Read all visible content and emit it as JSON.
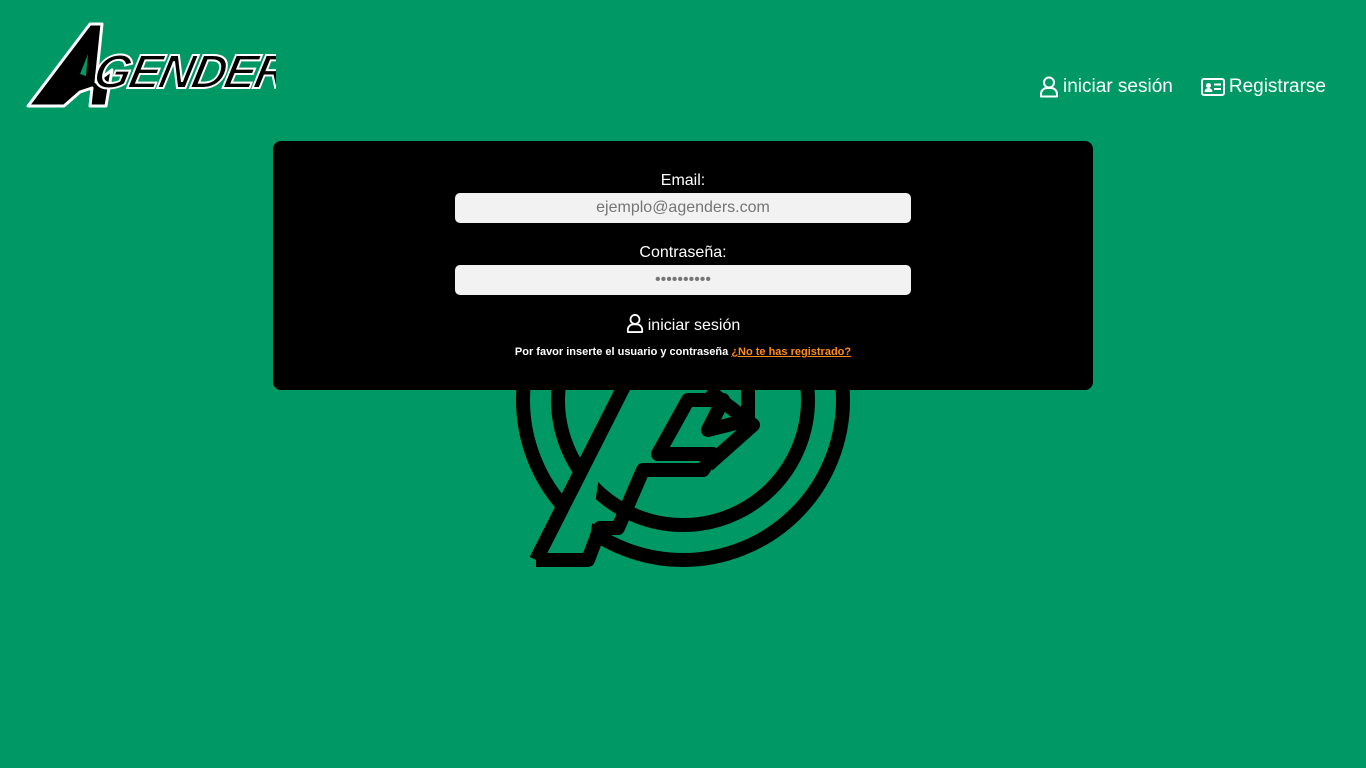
{
  "brand": {
    "logo_text": "AGENDERS"
  },
  "nav": {
    "login_label": "iniciar sesión",
    "login_icon": "user-icon",
    "register_label": "Registrarse",
    "register_icon": "id-card-icon"
  },
  "form": {
    "email_label": "Email:",
    "email_placeholder": "ejemplo@agenders.com",
    "email_value": "",
    "password_label": "Contraseña:",
    "password_placeholder": "••••••••••",
    "password_value": "",
    "submit_label": "iniciar sesión",
    "submit_icon": "user-icon",
    "hint_text": "Por favor inserte el usuario y contraseña",
    "register_link": "¿No te has registrado?"
  },
  "colors": {
    "background": "#009966",
    "card": "#000000",
    "link": "#ff8c1a",
    "input": "#f2f2f2"
  }
}
